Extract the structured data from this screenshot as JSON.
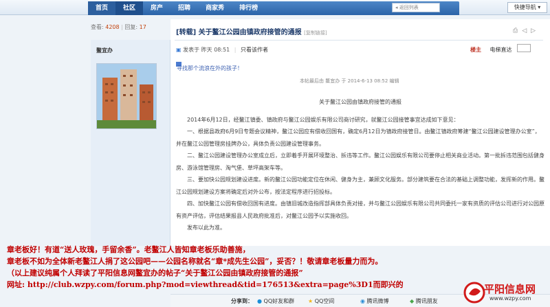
{
  "nav": {
    "tabs": [
      "首页",
      "社区",
      "房产",
      "招聘",
      "商家秀",
      "排行榜"
    ],
    "pager": "返回列表",
    "quick_nav": "快捷导航"
  },
  "thread": {
    "views_label": "查看:",
    "views": "4208",
    "replies_label": "回复:",
    "replies": "17",
    "author": "鳌宜办",
    "title": "[转载] 关于鳌江公园由镇政府接管的通报",
    "copy_link": "[复制链接]",
    "posted": "发表于 昨天 08:51",
    "view_only_author": "只看该作者",
    "floor": "楼主",
    "jump_label": "电梯直达",
    "ad_text": "寻找那个流浪在外的孩子！",
    "edited_note": "本帖最后由 鳌宜办 于 2014-6-13 08:52 编辑"
  },
  "article": {
    "heading": "关于鳌江公园由镇政府接管的通报",
    "paragraphs": [
      "2014年6月12日，经鳌江镇委、镇政府与鳌江公园娱乐有限公司商讨研究，就鳌江公园接管事宜达成如下意见：",
      "一、根据县政府6月9日专题会议精神，鳌江公园应有偿收回国有，确定6月12日为镇政府接管日。由鳌江镇政府筹建“鳌江公园建设管理办公室”，并在鳌江公园管理房挂牌办公，具体负责公园建设管理事务。",
      "二、鳌江公园建设管理办公室成立后，立即着手开展环境整治、拆违等工作。鳌江公园娱乐有限公司要停止相关商业活动。第一批拆违范围包括健身房、游泳馆管理房、淘气堡、草坪高架车等。",
      "三、要加快公园规划建设进度。新的鳌江公园功能定位在休闲、健身为主，兼顾文化服务。部分建筑要在合法的基础上调整功能，发挥新的作用。鳌江公园规划建设方案将确定后对外公布，按法定程序进行招投标。",
      "四、加快鳌江公园有偿收回国有进度。由镇旧城改造指挥部具体负责对接，并与鳌江公园娱乐有限公司共同委托一家有资质的评估公司进行对公园原有资产评估，评估结果报县人民政府批准后，对鳌江公园予以实施收回。",
      "发布以此为准。"
    ]
  },
  "overlay": {
    "lines": [
      "章老板好！有道“送人玫瑰，手留余香”。老鳌江人皆知章老板乐助善施，",
      "章老板不如为全体新老鳌江人捐了这公园吧——公园名称就名“章*成先生公园”，妥否？！敬请章老板量力而为。",
      "（以上建议纯属个人拜读了平阳信息网鳌宜办的帖子“关于鳌江公园由镇政府接管的通报”",
      "网址: http://club.wzpy.com/forum.php?mod=viewthread&tid=176513&extra=page%3D1而即兴的"
    ]
  },
  "share": {
    "label": "分享到：",
    "items": [
      "QQ好友和群",
      "QQ空间",
      "腾讯微博",
      "腾讯朋友"
    ]
  },
  "logo": {
    "name": "平阳信息网",
    "url": "www.wzpy.com"
  },
  "colors": {
    "nav_blue": "#2b64a8",
    "overlay_red": "#c00000",
    "logo_red": "#d11a1a"
  }
}
